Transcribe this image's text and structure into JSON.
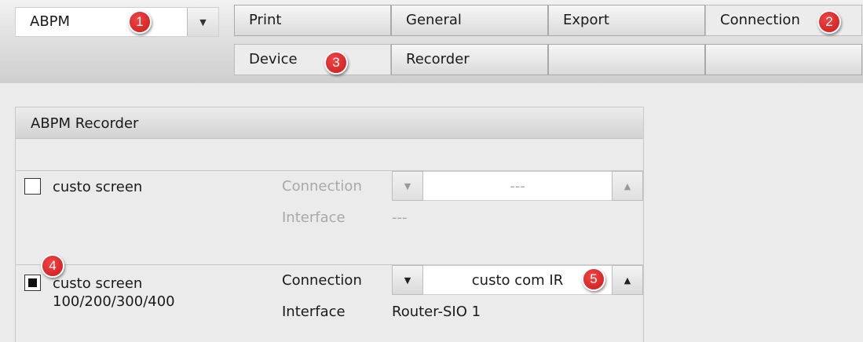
{
  "device_select": {
    "value": "ABPM"
  },
  "tabs_row1": [
    "Print",
    "General",
    "Export",
    "Connection"
  ],
  "tabs_row2": [
    "Device",
    "Recorder",
    "",
    ""
  ],
  "badges": [
    "1",
    "2",
    "3",
    "4",
    "5"
  ],
  "panel": {
    "title": "ABPM Recorder",
    "devices": [
      {
        "name": "custo screen",
        "checked": false,
        "connection_label": "Connection",
        "connection_value": "---",
        "interface_label": "Interface",
        "interface_value": "---",
        "enabled": false
      },
      {
        "name": "custo screen",
        "name_line2": "100/200/300/400",
        "checked": true,
        "connection_label": "Connection",
        "connection_value": "custo com IR",
        "interface_label": "Interface",
        "interface_value": "Router-SIO 1",
        "enabled": true
      }
    ]
  },
  "colors": {
    "badge": "#dd2b2b",
    "background": "#ebebeb",
    "disabled_text": "#a8a8a8"
  },
  "icons": {
    "dropdown": "triangle-down-icon",
    "up": "triangle-up-icon"
  }
}
